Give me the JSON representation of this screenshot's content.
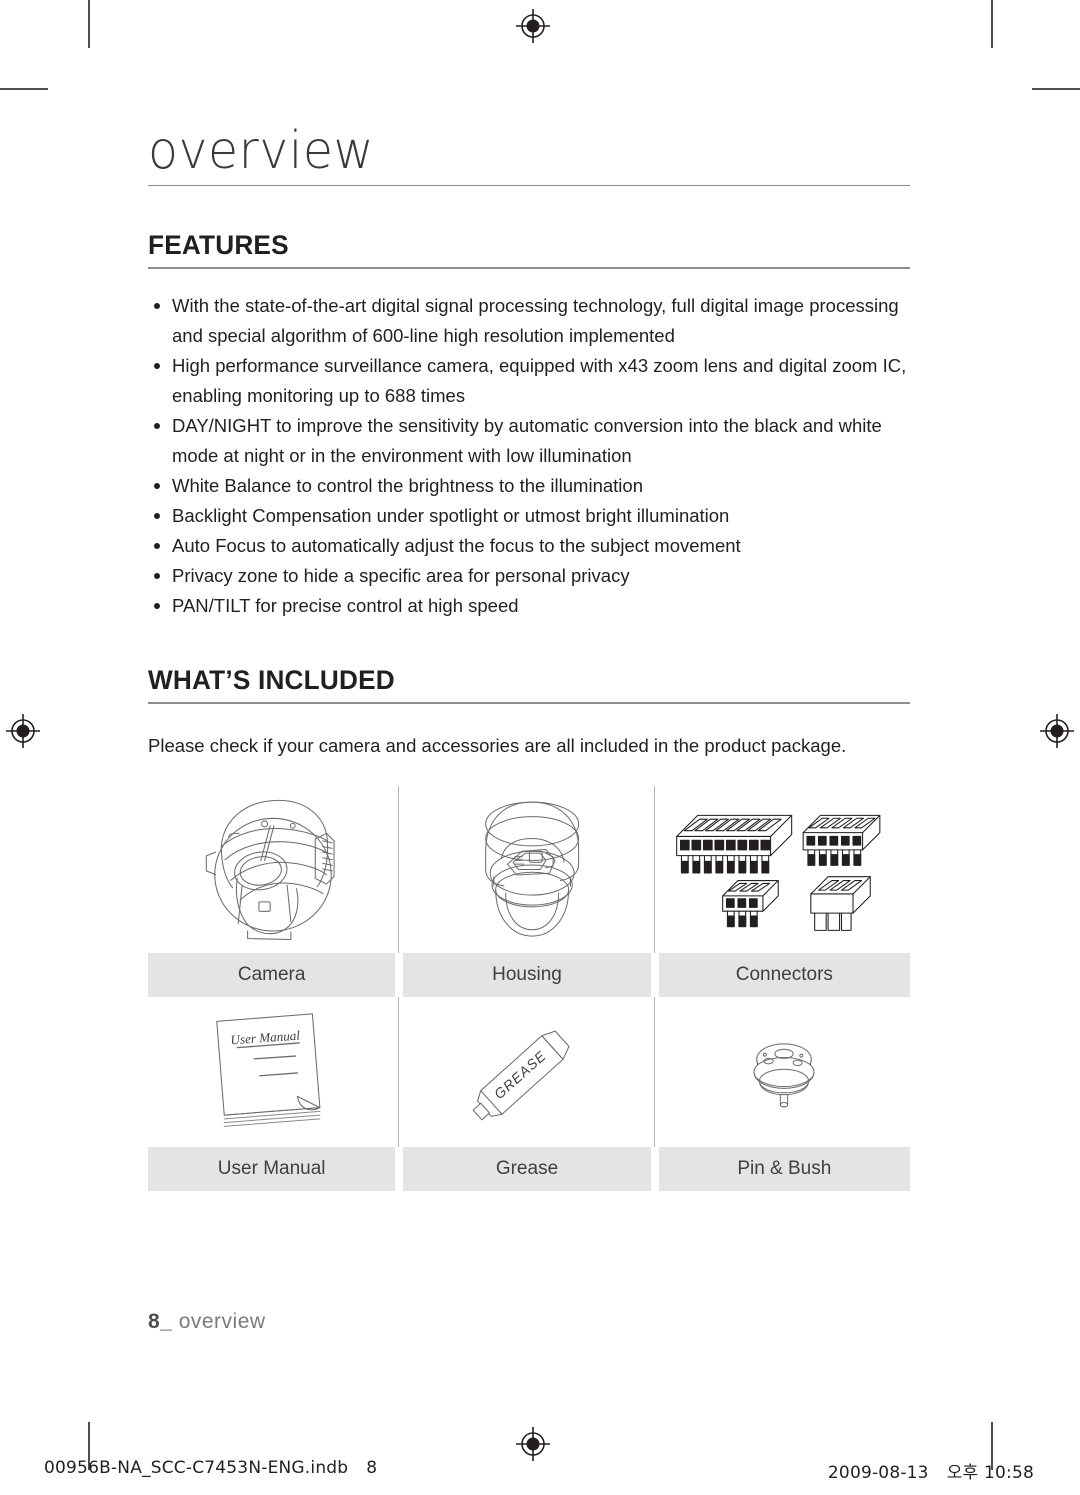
{
  "chapter": {
    "title": "overview"
  },
  "features": {
    "heading": "FEATURES",
    "items": [
      "With the state-of-the-art digital signal processing technology, full digital image processing and special algorithm of 600-line high resolution implemented",
      "High performance surveillance camera, equipped with x43 zoom lens and digital zoom IC, enabling monitoring up to 688 times",
      "DAY/NIGHT to improve the sensitivity by automatic conversion into the black and white mode at night or in the environment with low illumination",
      "White Balance to control the brightness to the illumination",
      "Backlight Compensation under spotlight or utmost bright illumination",
      "Auto Focus to automatically adjust the focus to the subject movement",
      "Privacy zone to hide a specific area for personal privacy",
      "PAN/TILT for precise control at high speed"
    ]
  },
  "whats_included": {
    "heading": "WHAT’S INCLUDED",
    "intro": "Please check if your camera and accessories are all included in the product package.",
    "items": [
      {
        "label": "Camera",
        "icon": "dome-camera-icon"
      },
      {
        "label": "Housing",
        "icon": "camera-housing-icon"
      },
      {
        "label": "Connectors",
        "icon": "terminal-connectors-icon"
      },
      {
        "label": "User Manual",
        "icon": "user-manual-icon"
      },
      {
        "label": "Grease",
        "icon": "grease-tube-icon"
      },
      {
        "label": "Pin & Bush",
        "icon": "pin-and-bush-icon"
      }
    ],
    "manual_cover_text": "User Manual",
    "grease_tube_text": "GREASE"
  },
  "footer": {
    "page_number": "8_",
    "section_name": "overview"
  },
  "print_footer": {
    "file_name": "00956B-NA_SCC-C7453N-ENG.indb",
    "page": "8",
    "date": "2009-08-13",
    "meridiem": "오후",
    "time": "10:58"
  },
  "colors": {
    "label_bar": "#e4e4e4",
    "rule": "#8d8d8f",
    "text": "#231f20",
    "muted_text": "#7b7b7e"
  }
}
